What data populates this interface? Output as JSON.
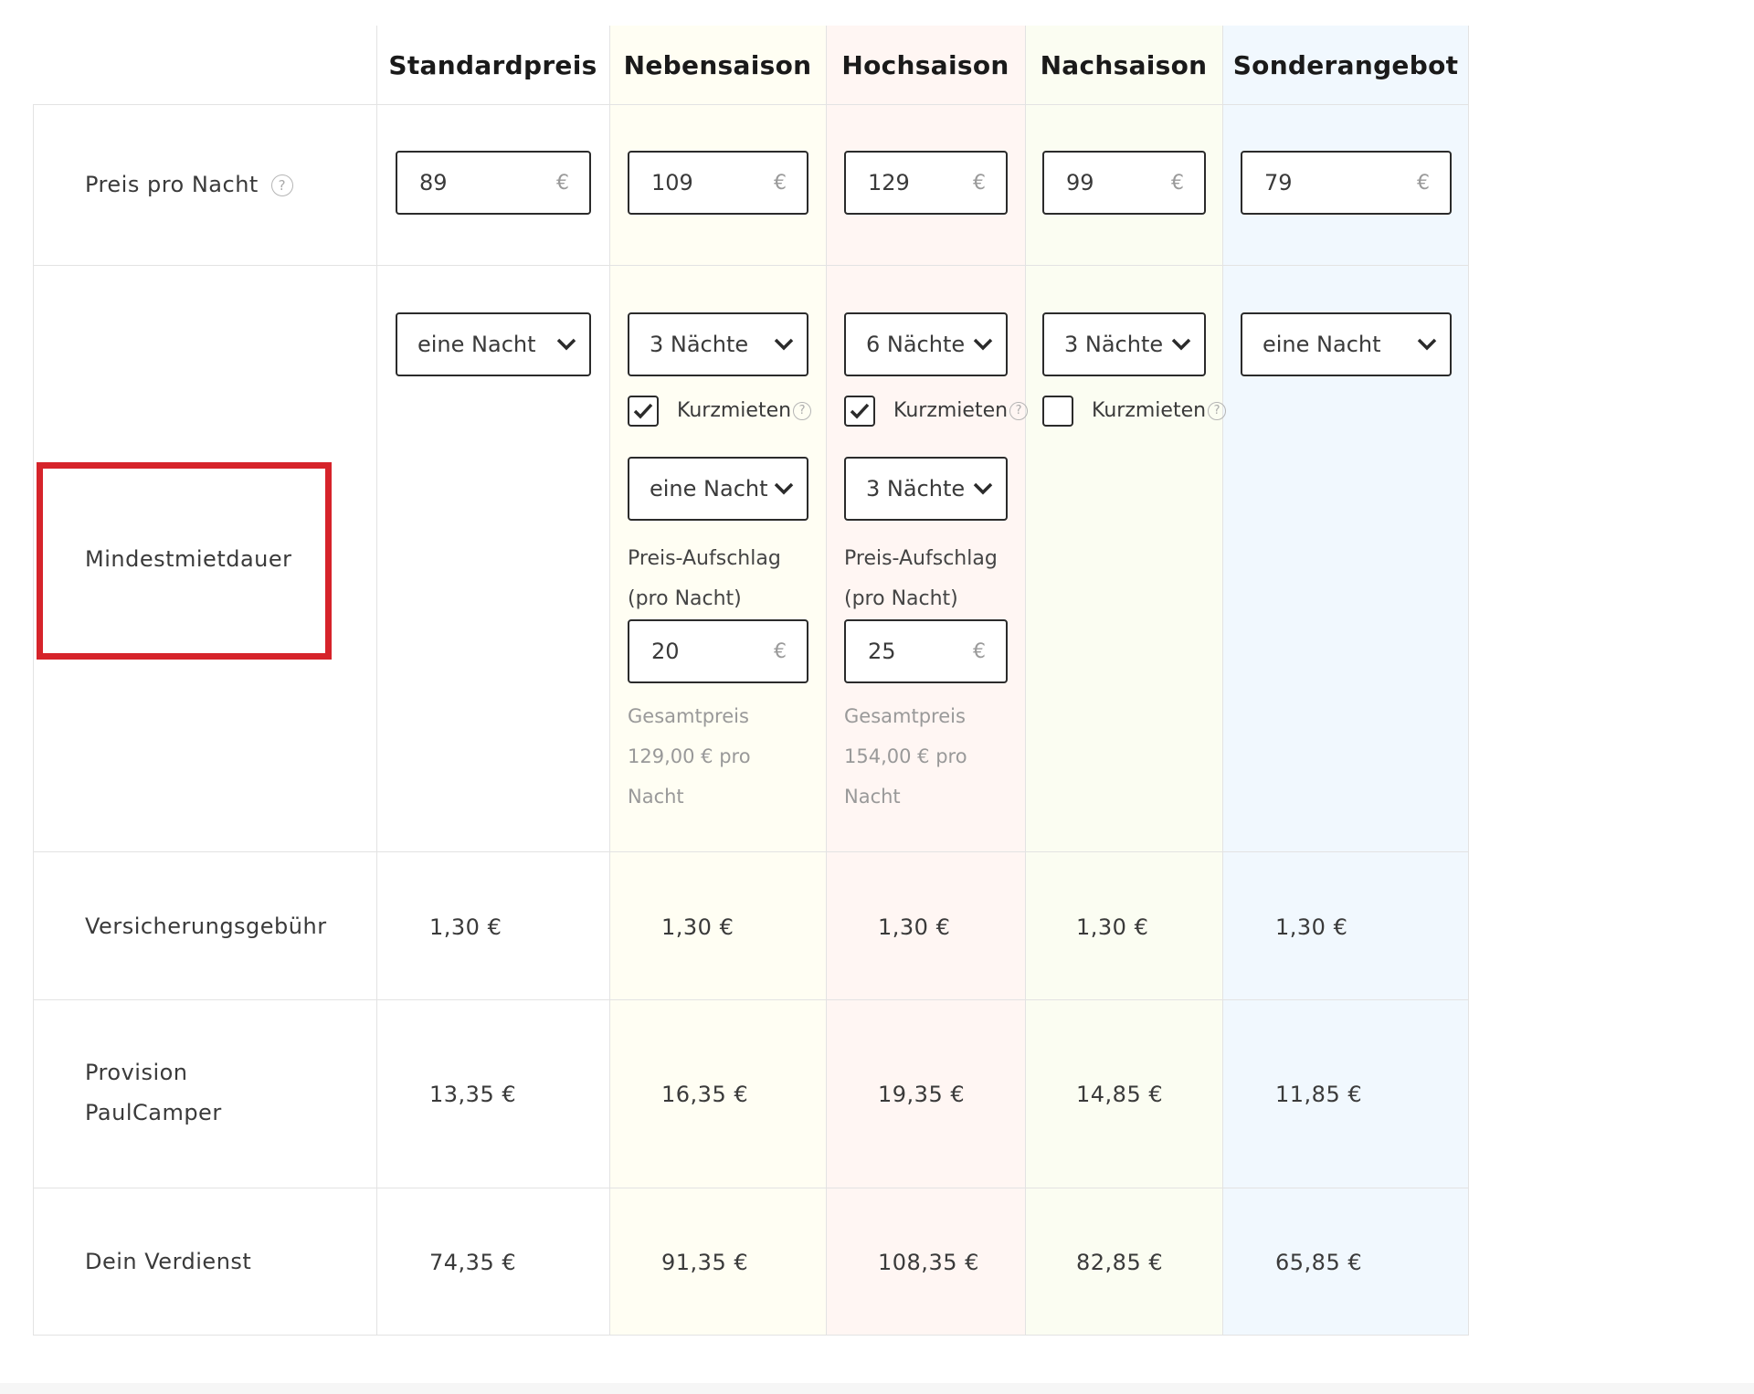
{
  "columns": [
    {
      "key": "standard",
      "label": "Standardpreis",
      "tint": "#ffffff"
    },
    {
      "key": "neben",
      "label": "Nebensaison",
      "tint": "#fffef3"
    },
    {
      "key": "hoch",
      "label": "Hochsaison",
      "tint": "#fff6f3"
    },
    {
      "key": "nach",
      "label": "Nachsaison",
      "tint": "#fbfdf2"
    },
    {
      "key": "sonder",
      "label": "Sonderangebot",
      "tint": "#f1f8fe"
    }
  ],
  "rows": {
    "price_per_night": {
      "label": "Preis pro Nacht",
      "help": "?",
      "values": [
        "89",
        "109",
        "129",
        "99",
        "79"
      ],
      "currency": "€"
    },
    "min_duration": {
      "label": "Mindestmietdauer",
      "selects": [
        "eine Nacht",
        "3 Nächte",
        "6 Nächte",
        "3 Nächte",
        "eine Nacht"
      ],
      "short_rental_label": "Kurzmieten",
      "short_rental_help": "?",
      "short_rental_checked": [
        true,
        true,
        false
      ],
      "short_selects": [
        "eine Nacht",
        "3 Nächte"
      ],
      "surcharge_label_1": "Preis-Aufschlag",
      "surcharge_label_2": "(pro Nacht)",
      "surcharges": [
        "20",
        "25"
      ],
      "total_label": "Gesamtpreis",
      "totals": [
        "129,00 € pro",
        "154,00 € pro"
      ],
      "total_suffix": "Nacht"
    },
    "insurance": {
      "label": "Versicherungsgebühr",
      "values": [
        "1,30 €",
        "1,30 €",
        "1,30 €",
        "1,30 €",
        "1,30 €"
      ]
    },
    "commission": {
      "label_1": "Provision",
      "label_2": "PaulCamper",
      "values": [
        "13,35 €",
        "16,35 €",
        "19,35 €",
        "14,85 €",
        "11,85 €"
      ]
    },
    "earnings": {
      "label": "Dein Verdienst",
      "values": [
        "74,35 €",
        "91,35 €",
        "108,35 €",
        "82,85 €",
        "65,85 €"
      ]
    }
  },
  "colors": {
    "highlight": "#d6232a",
    "border": "#2b2b2b",
    "grid": "#e3e3e3"
  }
}
